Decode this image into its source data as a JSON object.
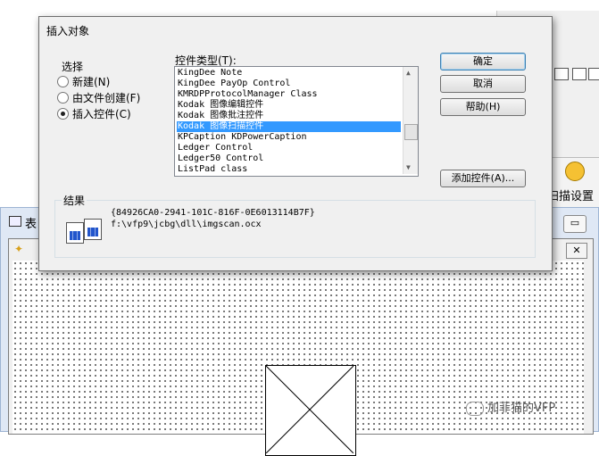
{
  "dialog": {
    "title": "插入对象",
    "choose_label": "选择",
    "radio_options": [
      {
        "label": "新建(N)",
        "checked": false
      },
      {
        "label": "由文件创建(F)",
        "checked": false
      },
      {
        "label": "插入控件(C)",
        "checked": true
      }
    ],
    "control_type_label": "控件类型(T):",
    "control_types": [
      {
        "label": "KingDee Note",
        "selected": false
      },
      {
        "label": "KingDee PayOp Control",
        "selected": false
      },
      {
        "label": "KMRDPProtocolManager  Class",
        "selected": false
      },
      {
        "label": "Kodak 图像编辑控件",
        "selected": false
      },
      {
        "label": "Kodak 图像批注控件",
        "selected": false
      },
      {
        "label": "Kodak 图像扫描控件",
        "selected": true
      },
      {
        "label": "KPCaption KDPowerCaption",
        "selected": false
      },
      {
        "label": "Ledger Control",
        "selected": false
      },
      {
        "label": "Ledger50 Control",
        "selected": false
      },
      {
        "label": "ListPad class",
        "selected": false
      }
    ],
    "buttons": {
      "ok": "确定",
      "cancel": "取消",
      "help": "帮助(H)",
      "add_control": "添加控件(A)..."
    },
    "result_label": "结果",
    "result_clsid": "{84926CA0-2941-101C-816F-0E6013114B7F}",
    "result_path": "f:\\vfp9\\jcbg\\dll\\imgscan.ocx"
  },
  "background": {
    "scan_settings_label": "扫描设置",
    "form_window_title": "表",
    "watermark": "加菲猫的VFP"
  },
  "colors": {
    "selection": "#3399ff",
    "dialog_bg": "#f0f0f0",
    "form_window_bg": "#dfe8f5"
  }
}
